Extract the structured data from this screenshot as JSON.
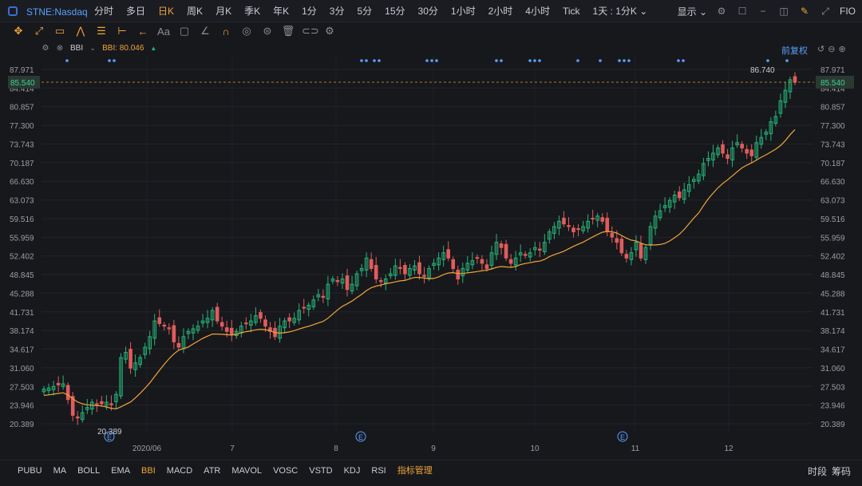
{
  "header": {
    "symbol": "STNE:Nasdaq",
    "timeframes": [
      "分时",
      "多日",
      "日K",
      "周K",
      "月K",
      "季K",
      "年K",
      "1分",
      "3分",
      "5分",
      "15分",
      "30分",
      "1小时",
      "2小时",
      "4小时",
      "Tick",
      "1天 : 1分K ⌄"
    ],
    "active_timeframe": "日K",
    "display_label": "显示 ⌄",
    "right_text": "FIO"
  },
  "indicator": {
    "name": "BBI",
    "value_label": "BBI: 80.046",
    "adjust_label": "前复权"
  },
  "price_axis": {
    "ticks": [
      "87.971",
      "84.414",
      "80.857",
      "77.300",
      "73.743",
      "70.187",
      "66.630",
      "63.073",
      "59.516",
      "55.959",
      "52.402",
      "48.845",
      "45.288",
      "41.731",
      "38.174",
      "34.617",
      "31.060",
      "27.503",
      "23.946",
      "20.389"
    ],
    "current_price": "85.540",
    "high_label": "86.740",
    "low_label": "20.389"
  },
  "time_axis": {
    "labels": [
      "2020/06",
      "7",
      "8",
      "9",
      "10",
      "11",
      "12"
    ]
  },
  "event_marker": "E",
  "bottom": {
    "indicators": [
      "PUBU",
      "MA",
      "BOLL",
      "EMA",
      "BBI",
      "MACD",
      "ATR",
      "MAVOL",
      "VOSC",
      "VSTD",
      "KDJ",
      "RSI",
      "指标管理"
    ],
    "active": "BBI",
    "right_items": [
      "时段",
      "筹码"
    ]
  },
  "colors": {
    "up": "#26b47a",
    "down": "#e05c5c",
    "bbi": "#f0a43a",
    "accent": "#f0a43a",
    "link": "#5aa0ff"
  },
  "chart_data": {
    "type": "candlestick",
    "ylim": [
      20.389,
      87.971
    ],
    "months": [
      "2020/06",
      "7",
      "8",
      "9",
      "10",
      "11",
      "12"
    ],
    "close_series": [
      27.0,
      27.2,
      27.5,
      27.8,
      28.0,
      25.0,
      22.0,
      21.5,
      22.5,
      23.5,
      24.5,
      24.0,
      24.2,
      24.5,
      24.0,
      26.0,
      33.0,
      34.0,
      31.0,
      32.0,
      33.0,
      35.0,
      37.0,
      40.0,
      39.5,
      39.0,
      38.5,
      36.0,
      35.0,
      37.0,
      38.0,
      38.5,
      39.0,
      40.0,
      40.5,
      42.0,
      40.0,
      39.0,
      38.0,
      37.5,
      38.0,
      39.0,
      39.5,
      40.0,
      41.0,
      40.5,
      39.0,
      38.0,
      37.0,
      39.0,
      40.0,
      40.0,
      40.5,
      42.0,
      42.5,
      43.0,
      44.0,
      45.0,
      44.5,
      47.0,
      48.0,
      47.5,
      48.0,
      46.0,
      47.0,
      49.0,
      50.0,
      52.0,
      50.0,
      48.0,
      47.5,
      48.0,
      49.0,
      50.5,
      50.0,
      49.0,
      50.0,
      50.5,
      49.0,
      48.5,
      50.0,
      51.0,
      52.0,
      53.0,
      52.0,
      50.0,
      48.0,
      50.0,
      51.0,
      51.5,
      52.0,
      51.0,
      50.0,
      53.0,
      55.0,
      54.0,
      52.0,
      51.0,
      52.0,
      53.0,
      52.5,
      53.0,
      54.0,
      53.5,
      55.0,
      57.0,
      58.0,
      59.0,
      58.5,
      58.0,
      57.0,
      57.5,
      58.0,
      59.0,
      59.5,
      60.0,
      59.0,
      57.0,
      56.0,
      55.0,
      53.0,
      52.0,
      53.0,
      55.0,
      52.0,
      54.0,
      58.0,
      60.0,
      61.0,
      62.0,
      63.0,
      64.0,
      63.5,
      65.0,
      66.0,
      67.0,
      68.0,
      70.0,
      71.0,
      72.0,
      73.0,
      72.0,
      71.0,
      73.0,
      74.0,
      73.0,
      72.0,
      71.5,
      74.0,
      75.0,
      76.0,
      78.0,
      79.0,
      82.0,
      84.0,
      86.0,
      85.54
    ],
    "bbi_end": 80.046
  }
}
